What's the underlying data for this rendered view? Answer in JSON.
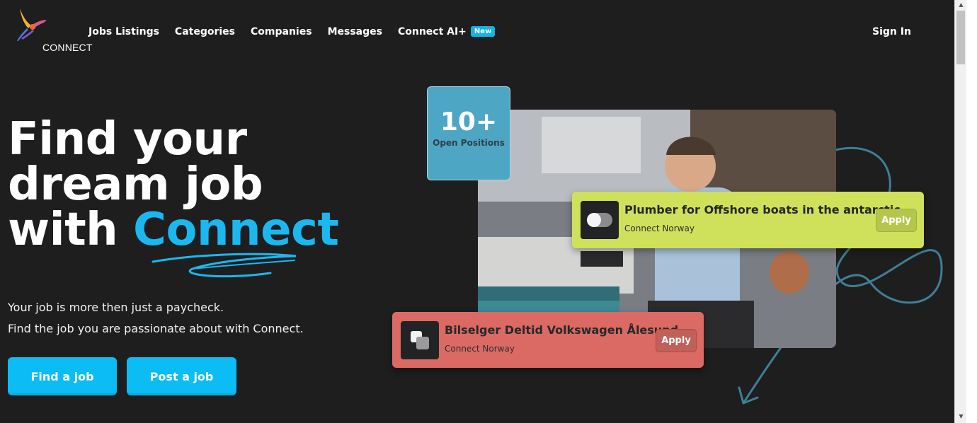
{
  "nav": {
    "logo_text": "CONNECT",
    "links": [
      "Jobs Listings",
      "Categories",
      "Companies",
      "Messages",
      "Connect AI+"
    ],
    "new_badge": "New",
    "sign_in": "Sign In"
  },
  "hero": {
    "line1": "Find your",
    "line2": "dream job",
    "line3_prefix": "with ",
    "line3_accent": "Connect",
    "subtitle1": "Your job is more then just a paycheck.",
    "subtitle2": "Find the job you are passionate about with Connect.",
    "find_button": "Find a job",
    "post_button": "Post a job"
  },
  "stats": {
    "count": "10+",
    "label": "Open Positions"
  },
  "jobs": [
    {
      "title": "Plumber for Offshore boats in the antarctic",
      "company": "Connect Norway",
      "apply": "Apply",
      "color": "#cfe15a",
      "icon": "toggle-icon"
    },
    {
      "title": "Bilselger Deltid Volkswagen Ålesund",
      "company": "Connect Norway",
      "apply": "Apply",
      "color": "#db6a64",
      "icon": "squares-icon"
    }
  ],
  "colors": {
    "background": "#1e1e1f",
    "accent": "#1bb7ef",
    "button": "#0bbcf5",
    "stats_box": "#4ea6c5"
  }
}
